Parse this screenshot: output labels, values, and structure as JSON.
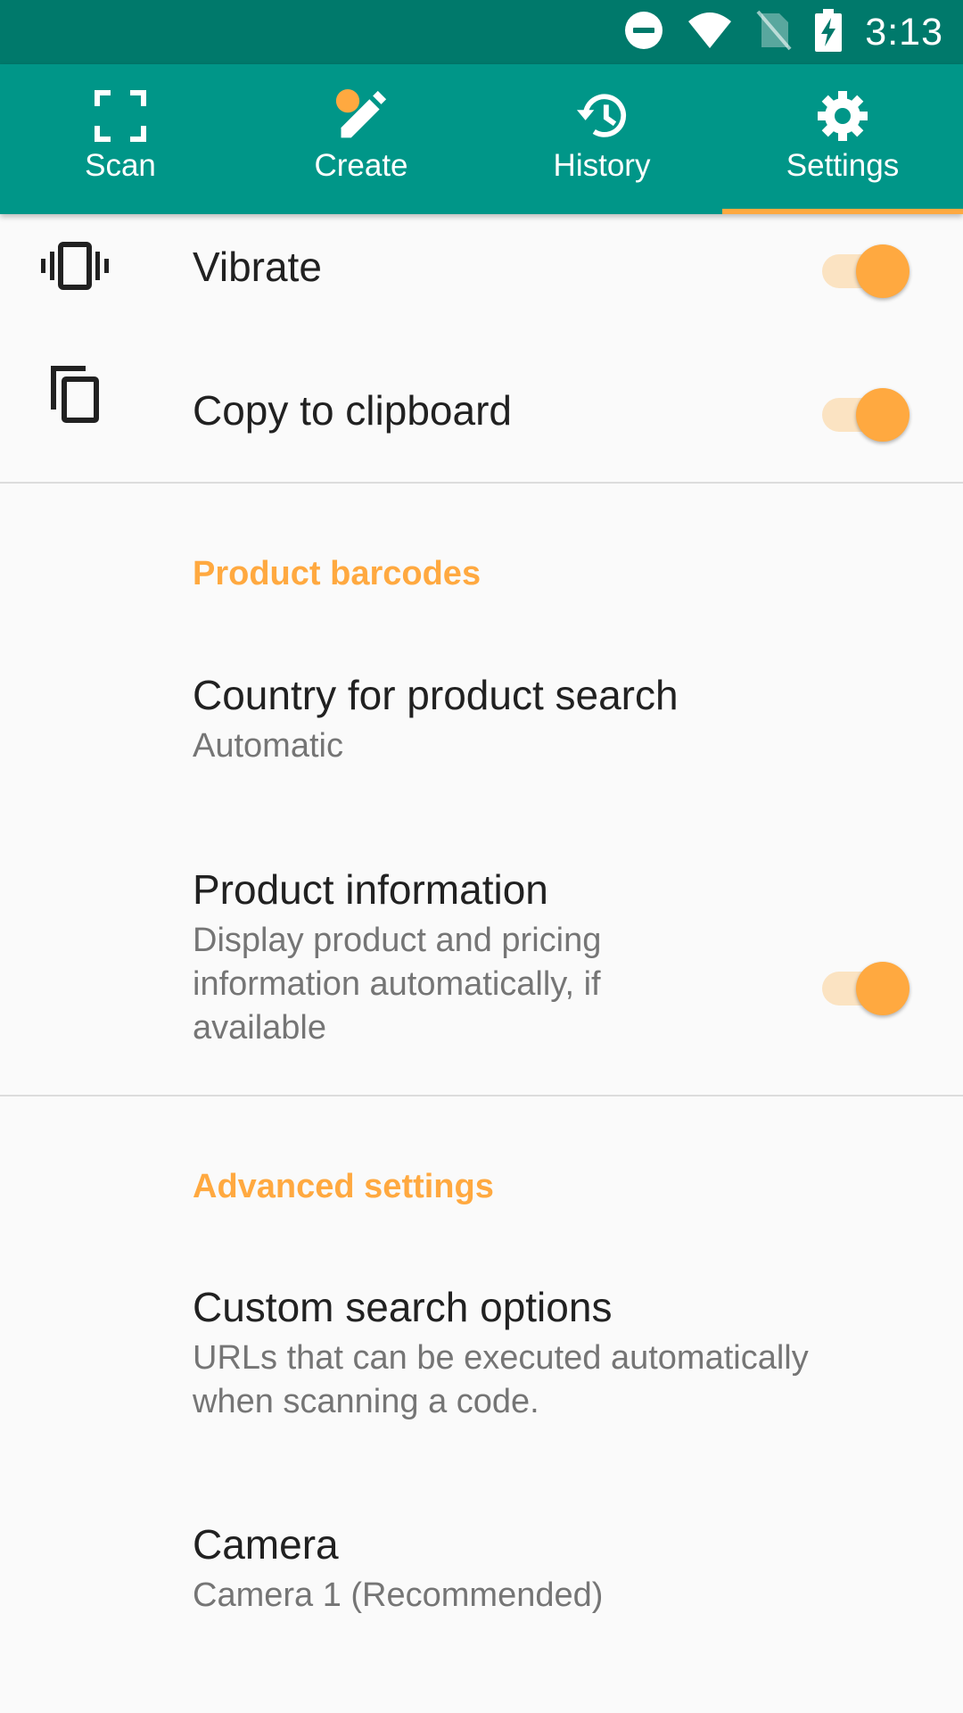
{
  "status_bar": {
    "time": "3:13",
    "icons": [
      "do-not-disturb-icon",
      "wifi-icon",
      "no-sim-icon",
      "battery-charging-icon"
    ]
  },
  "tabs": [
    {
      "label": "Scan",
      "icon": "scan-icon",
      "selected": false
    },
    {
      "label": "Create",
      "icon": "create-icon",
      "selected": false
    },
    {
      "label": "History",
      "icon": "history-icon",
      "selected": false
    },
    {
      "label": "Settings",
      "icon": "settings-icon",
      "selected": true
    }
  ],
  "settings": {
    "vibrate": {
      "title": "Vibrate",
      "icon": "vibrate-icon",
      "enabled": true
    },
    "copy_clipboard": {
      "title": "Copy to clipboard",
      "icon": "copy-icon",
      "enabled": true
    },
    "product_barcodes_header": "Product barcodes",
    "country": {
      "title": "Country for product search",
      "summary": "Automatic"
    },
    "product_info": {
      "title": "Product information",
      "summary_lines": [
        "Display product and pricing",
        "information automatically, if",
        "available"
      ],
      "enabled": true
    },
    "advanced_header": "Advanced settings",
    "custom_search": {
      "title": "Custom search options",
      "summary_lines": [
        "URLs that can be executed automatically",
        "when scanning a code."
      ]
    },
    "camera": {
      "title": "Camera",
      "summary": "Camera 1 (Recommended)"
    }
  },
  "colors": {
    "status_bar": "#00796b",
    "toolbar": "#009688",
    "accent": "#ffa940",
    "background": "#fafafa"
  }
}
